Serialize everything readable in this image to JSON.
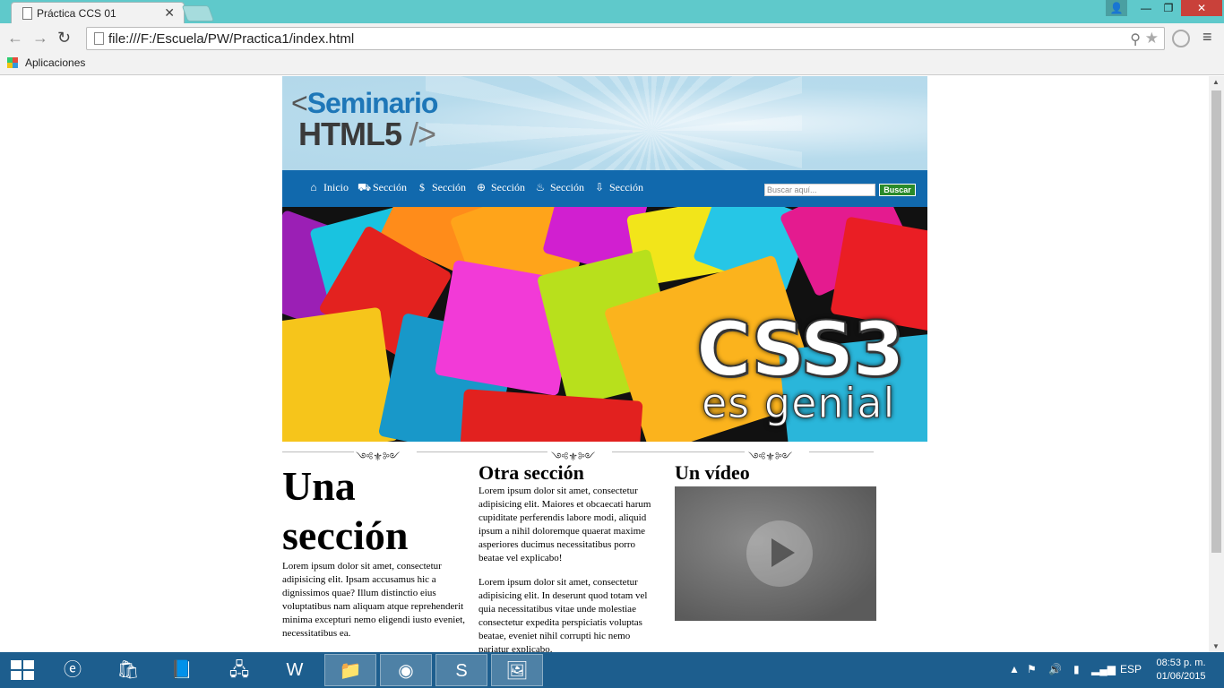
{
  "browser": {
    "tab_title": "Práctica CCS 01",
    "address": "file:///F:/Escuela/PW/Practica1/index.html",
    "bookmark_apps": "Aplicaciones"
  },
  "banner": {
    "line1_bracket": "<",
    "line1": "Seminario",
    "line2": "HTML5",
    "line2_bracket": "/>"
  },
  "nav": {
    "items": [
      {
        "label": "Inicio",
        "icon": "home-icon",
        "glyph": "⌂"
      },
      {
        "label": "Sección",
        "icon": "truck-icon",
        "glyph": "⛟"
      },
      {
        "label": "Sección",
        "icon": "dollar-icon",
        "glyph": "$"
      },
      {
        "label": "Sección",
        "icon": "globe-icon",
        "glyph": "⊕"
      },
      {
        "label": "Sección",
        "icon": "fire-icon",
        "glyph": "♨"
      },
      {
        "label": "Sección",
        "icon": "download-icon",
        "glyph": "⇩"
      }
    ],
    "search_placeholder": "Buscar aquí...",
    "search_button": "Buscar"
  },
  "hero": {
    "title": "CSS3",
    "subtitle": "es genial"
  },
  "columns": {
    "col1_title": "Una sección",
    "col1_p1": "Lorem ipsum dolor sit amet, consectetur adipisicing elit. Ipsam accusamus hic a dignissimos quae? Illum distinctio eius voluptatibus nam aliquam atque reprehenderit minima excepturi nemo eligendi iusto eveniet, necessitatibus ea.",
    "col2_title": "Otra sección",
    "col2_p1": "Lorem ipsum dolor sit amet, consectetur adipisicing elit. Maiores et obcaecati harum cupiditate perferendis labore modi, aliquid ipsum a nihil doloremque quaerat maxime asperiores ducimus necessitatibus porro beatae vel explicabo!",
    "col2_p2": "Lorem ipsum dolor sit amet, consectetur adipisicing elit. In deserunt quod totam vel quia necessitatibus vitae unde molestiae consectetur expedita perspiciatis voluptas beatae, eveniet nihil corrupti hic nemo pariatur explicabo.",
    "col3_title": "Un vídeo"
  },
  "taskbar": {
    "language": "ESP",
    "time": "08:53 p. m.",
    "date": "01/06/2015"
  },
  "colors": {
    "titlebar": "#5fc9cb",
    "navbar": "#1169ad",
    "banner": "#b3d8ea",
    "taskbar": "#1d5e8e",
    "search_button": "#2a8a2a"
  }
}
